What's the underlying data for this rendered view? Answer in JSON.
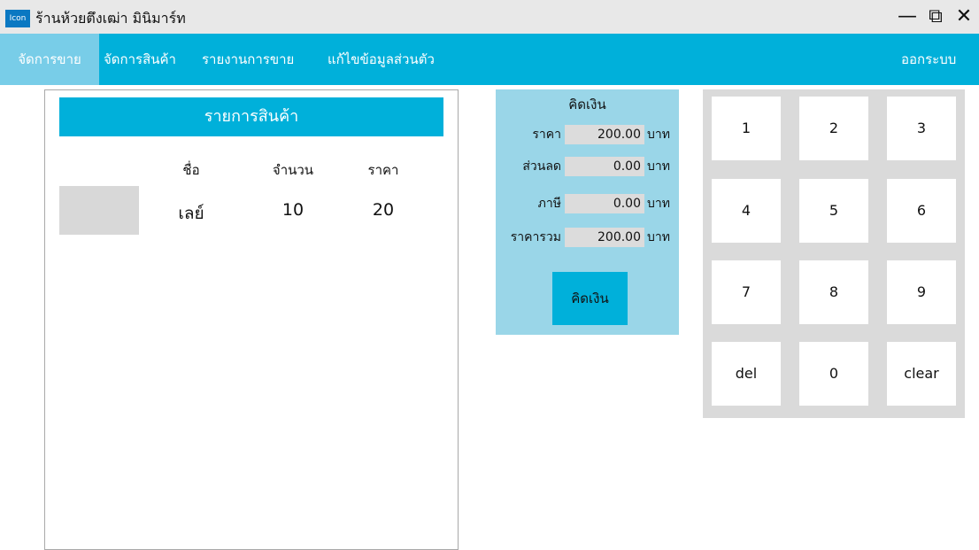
{
  "window": {
    "icon_text": "Icon",
    "title": "ร้านห้วยตึงเฒ่า มินิมาร์ท",
    "minimize_glyph": "—",
    "restore_glyph": "⧉",
    "close_glyph": "✕"
  },
  "menu": {
    "items": [
      {
        "label": "จัดการขาย",
        "active": true
      },
      {
        "label": "จัดการสินค้า",
        "active": false
      },
      {
        "label": "รายงานการขาย",
        "active": false
      },
      {
        "label": "แก้ไขข้อมูลส่วนตัว",
        "active": false
      }
    ],
    "logout_label": "ออกระบบ"
  },
  "products": {
    "header": "รายการสินค้า",
    "columns": {
      "name": "ชื่อ",
      "qty": "จำนวน",
      "price": "ราคา"
    },
    "rows": [
      {
        "name": "เลย์",
        "qty": "10",
        "price": "20"
      }
    ]
  },
  "checkout": {
    "title": "คิดเงิน",
    "fields": [
      {
        "label": "ราคา",
        "value": "200.00",
        "unit": "บาท"
      },
      {
        "label": "ส่วนลด",
        "value": "0.00",
        "unit": "บาท"
      },
      {
        "label": "ภาษี",
        "value": "0.00",
        "unit": "บาท"
      },
      {
        "label": "ราคารวม",
        "value": "200.00",
        "unit": "บาท"
      }
    ],
    "button_label": "คิดเงิน"
  },
  "keypad": {
    "keys": [
      "1",
      "2",
      "3",
      "4",
      "5",
      "6",
      "7",
      "8",
      "9",
      "del",
      "0",
      "clear"
    ]
  },
  "colors": {
    "accent": "#00b0da",
    "active_menu": "#78cde8",
    "checkout_bg": "#9ad6e8",
    "keypad_bg": "#dadada"
  }
}
